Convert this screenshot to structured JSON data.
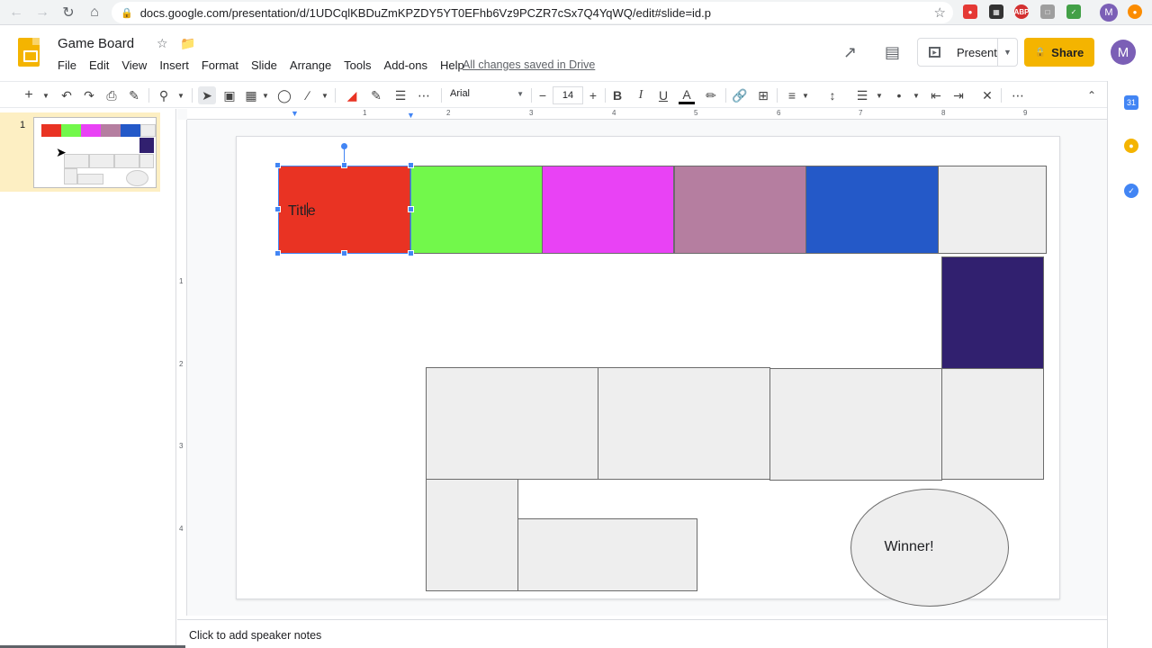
{
  "browser": {
    "url": "docs.google.com/presentation/d/1UDCqlKBDuZmKPZDY5YT0EFhb6Vz9PCZR7cSx7Q4YqWQ/edit#slide=id.p",
    "avatar_letter": "M",
    "extension_labels": [
      "ABP"
    ]
  },
  "app": {
    "doc_title": "Game Board",
    "menu": [
      "File",
      "Edit",
      "View",
      "Insert",
      "Format",
      "Slide",
      "Arrange",
      "Tools",
      "Add-ons",
      "Help"
    ],
    "save_status": "All changes saved in Drive",
    "present_label": "Present",
    "share_label": "Share",
    "avatar_letter": "M",
    "brand_color": "#f4b400"
  },
  "toolbar": {
    "font_name": "Arial",
    "font_size": "14",
    "bold": "B",
    "italic": "I",
    "underline": "U",
    "text_color": "A"
  },
  "ruler": {
    "h_numbers": [
      "1",
      "2",
      "3",
      "4",
      "5",
      "6",
      "7",
      "8",
      "9"
    ],
    "v_numbers": [
      "1",
      "2",
      "3",
      "4"
    ]
  },
  "filmstrip": {
    "slide_number": "1"
  },
  "slide": {
    "title_text_before_caret": "Titl",
    "title_text_after_caret": "e",
    "winner_label": "Winner!",
    "colors": {
      "red": "#e93323",
      "green": "#72f84b",
      "magenta": "#e942f5",
      "mauve": "#b57ea0",
      "blue": "#2459c8",
      "navy": "#31206f",
      "gray": "#eeeeee"
    }
  },
  "notes": {
    "placeholder": "Click to add speaker notes"
  }
}
